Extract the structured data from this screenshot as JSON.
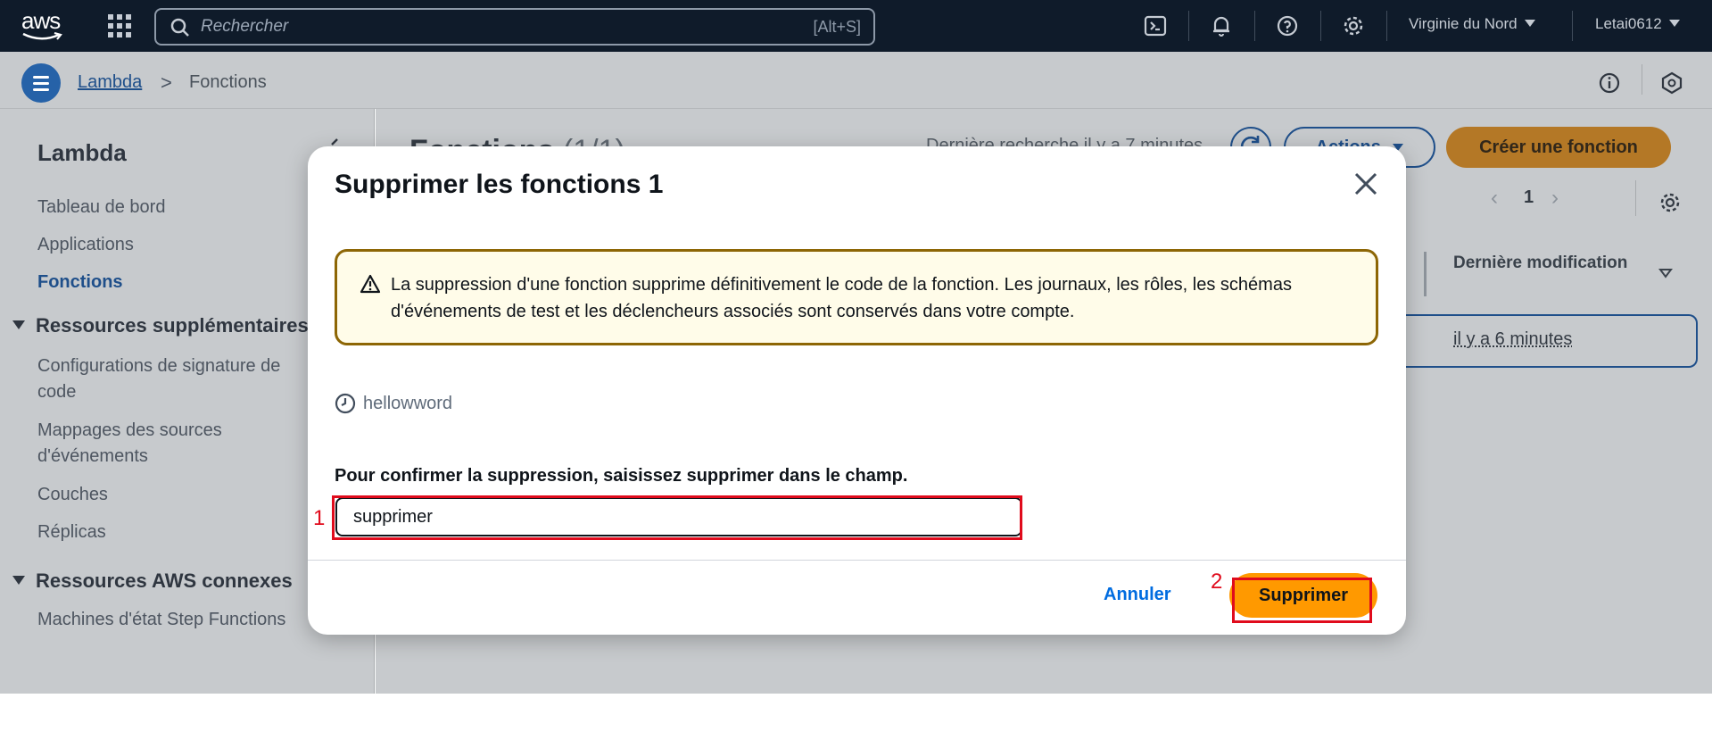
{
  "topnav": {
    "logo_text": "aws",
    "search_placeholder": "Rechercher",
    "search_shortcut": "[Alt+S]",
    "region": "Virginie du Nord",
    "account": "Letai0612"
  },
  "breadcrumb": {
    "parent": "Lambda",
    "separator": ">",
    "current": "Fonctions"
  },
  "sidebar": {
    "title": "Lambda",
    "items": [
      {
        "label": "Tableau de bord"
      },
      {
        "label": "Applications"
      },
      {
        "label": "Fonctions",
        "active": true
      }
    ],
    "sections": [
      {
        "label": "Ressources supplémentaires",
        "items": [
          "Configurations de signature de code",
          "Mappages des sources d'événements",
          "Couches",
          "Réplicas"
        ]
      },
      {
        "label": "Ressources AWS connexes",
        "items": [
          "Machines d'état Step Functions"
        ]
      }
    ]
  },
  "main": {
    "title": "Fonctions",
    "count": "(1/1)",
    "last_search": "Dernière recherche il y a 7 minutes",
    "actions_label": "Actions",
    "create_label": "Créer une fonction",
    "page": "1",
    "column_header": "Dernière modification",
    "row_last_modified": "il y a 6 minutes"
  },
  "modal": {
    "title": "Supprimer les fonctions 1",
    "alert_text": "La suppression d'une fonction supprime définitivement le code de la fonction. Les journaux, les rôles, les schémas d'événements de test et les déclencheurs associés sont conservés dans votre compte.",
    "function_name": "hellowword",
    "confirm_prefix": "Pour confirmer la suppression, saisissez ",
    "confirm_keyword": "supprimer",
    "confirm_suffix": " dans le champ.",
    "input_value": "supprimer",
    "cancel_label": "Annuler",
    "delete_label": "Supprimer"
  },
  "annotations": {
    "step1": "1",
    "step2": "2",
    "color": "#e00b1c"
  },
  "colors": {
    "nav_bg": "#0f1b2a",
    "primary": "#ff9900",
    "link": "#006ce0",
    "warning_border": "#8d6605",
    "warning_bg": "#fffce9"
  }
}
